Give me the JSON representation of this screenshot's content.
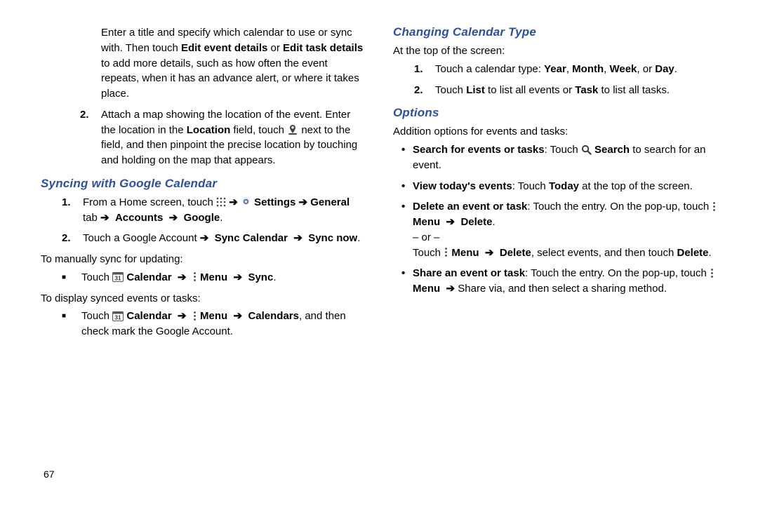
{
  "page_number": "67",
  "left": {
    "intro_step1": "Enter a title and specify which calendar to use or sync with. Then touch ",
    "intro_step1_bold1": "Edit event details",
    "intro_step1_mid": " or ",
    "intro_step1_bold2": "Edit task details",
    "intro_step1_tail": " to add more details, such as how often the event repeats, when it has an advance alert, or where it takes place.",
    "step2_num": "2.",
    "step2_a": "Attach a map showing the location of the event. Enter the location in the ",
    "step2_b": "Location",
    "step2_c": " field, touch ",
    "step2_d": " next to the field, and then pinpoint the precise location by touching and holding on the map that appears.",
    "h1": "Syncing with Google Calendar",
    "sync1_num": "1.",
    "sync1_a": "From a Home screen, touch ",
    "sync1_b_arrow": "➔",
    "sync1_c": " Settings ",
    "sync1_d": "General",
    "sync1_e": " tab ",
    "sync1_f": "Accounts",
    "sync1_g": "Google",
    "sync2_num": "2.",
    "sync2_a": "Touch a Google Account ",
    "sync2_b": "Sync Calendar",
    "sync2_c": "Sync now",
    "manual": "To manually sync for updating:",
    "manual_li_a": "Touch ",
    "manual_li_b": " Calendar",
    "manual_li_c": " Menu",
    "manual_li_d": "Sync",
    "display": "To display synced events or tasks:",
    "display_li_a": "Touch ",
    "display_li_b": " Calendar",
    "display_li_c": " Menu",
    "display_li_d": "Calendars",
    "display_li_e": ", and then check mark the Google Account."
  },
  "right": {
    "h2": "Changing Calendar Type",
    "top": "At the top of the screen:",
    "ct1_num": "1.",
    "ct1_a": "Touch a calendar type: ",
    "ct1_b": "Year",
    "ct1_c": "Month",
    "ct1_d": "Week",
    "ct1_e": "Day",
    "ct2_num": "2.",
    "ct2_a": "Touch ",
    "ct2_b": "List",
    "ct2_c": " to list all events or ",
    "ct2_d": "Task",
    "ct2_e": " to list all tasks.",
    "h3": "Options",
    "opt_intro": "Addition options for events and tasks:",
    "o1_a": "Search for events or tasks",
    "o1_b": ": Touch ",
    "o1_c": " Search",
    "o1_d": " to search for an event.",
    "o2_a": "View today's events",
    "o2_b": ": Touch ",
    "o2_c": "Today",
    "o2_d": " at the top of the screen.",
    "o3_a": "Delete an event or task",
    "o3_b": ": Touch the entry. On the pop-up, touch ",
    "o3_c": " Menu",
    "o3_d": "Delete",
    "o3_or": "– or –",
    "o3_e": "Touch ",
    "o3_f": " Menu",
    "o3_g": "Delete",
    "o3_h": ", select events, and then touch ",
    "o3_i": "Delete",
    "o4_a": "Share an event or task",
    "o4_b": ": Touch the entry. On the pop-up, touch ",
    "o4_c": " Menu",
    "o4_d": " Share via, and then select a sharing method."
  }
}
